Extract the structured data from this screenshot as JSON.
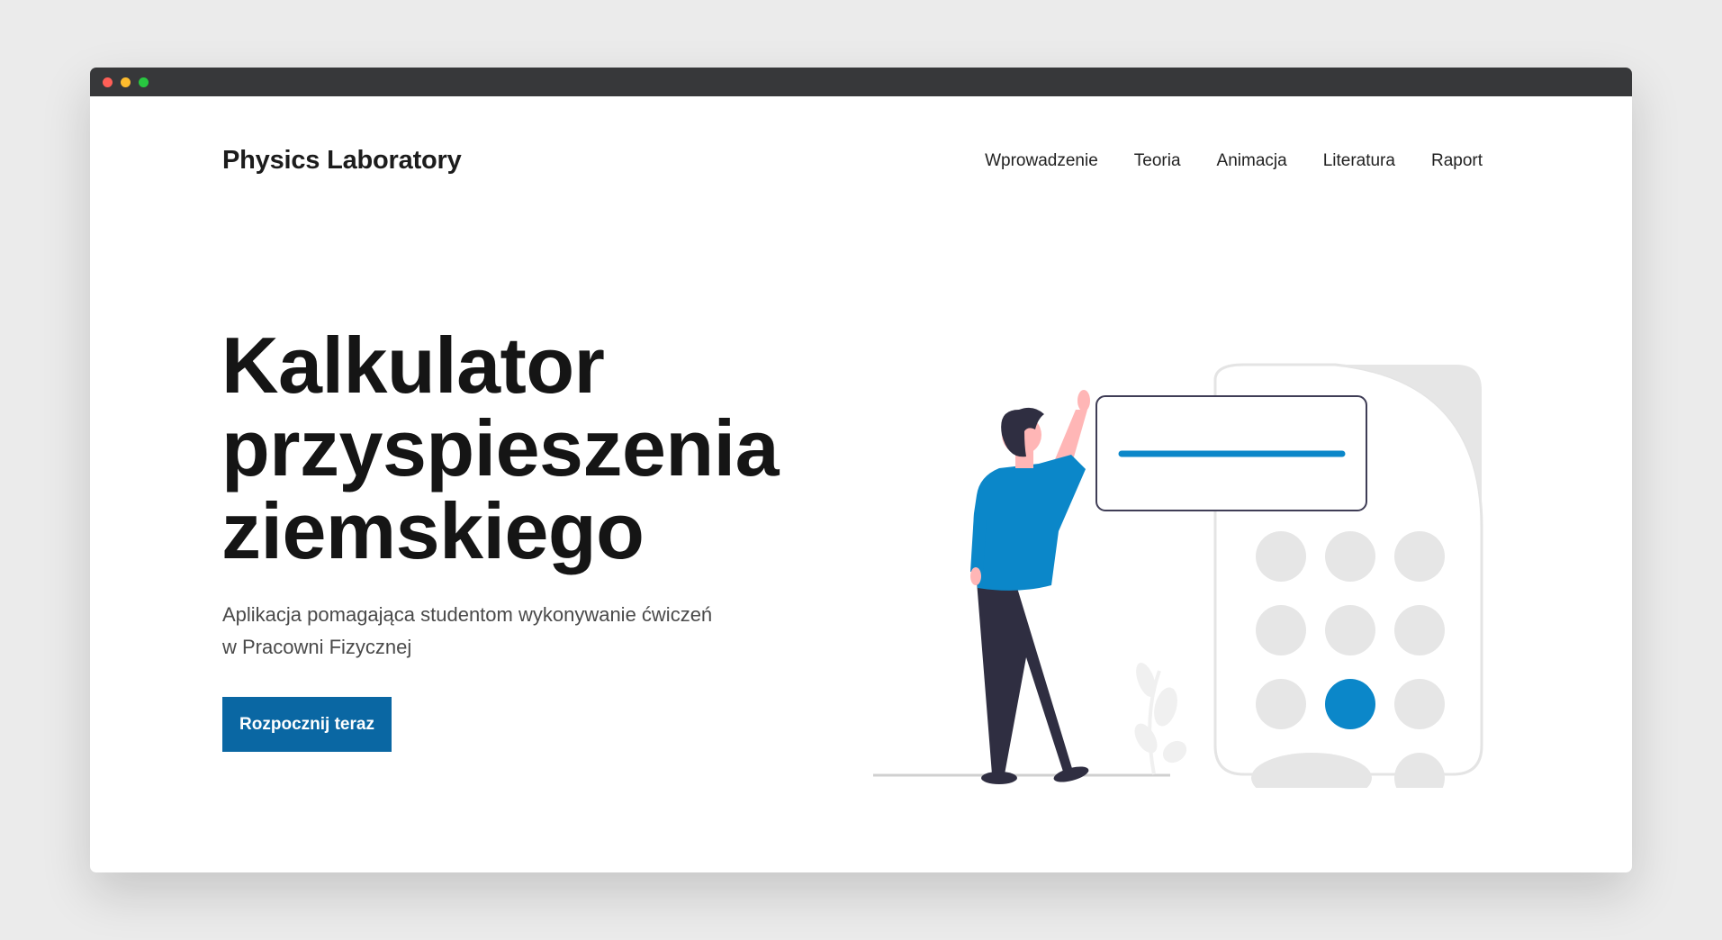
{
  "window_controls": [
    "close",
    "minimize",
    "maximize"
  ],
  "brand": "Physics Laboratory",
  "nav": [
    {
      "label": "Wprowadzenie"
    },
    {
      "label": "Teoria"
    },
    {
      "label": "Animacja"
    },
    {
      "label": "Literatura"
    },
    {
      "label": "Raport"
    }
  ],
  "hero": {
    "title_lines": [
      "Kalkulator",
      "przyspieszenia",
      "ziemskiego"
    ],
    "subtitle_lines": [
      "Aplikacja pomagająca studentom wykonywanie ćwiczeń",
      "w Pracowni Fizycznej"
    ],
    "cta_label": "Rozpocznij teraz"
  },
  "colors": {
    "accent": "#0a67a3",
    "illustration_blue": "#0b87c9",
    "dark": "#2f2e41",
    "skin": "#ffb6b6",
    "light_gray": "#e6e6e6"
  },
  "icons": {
    "illustration": "person-pressing-calculator-illustration"
  }
}
